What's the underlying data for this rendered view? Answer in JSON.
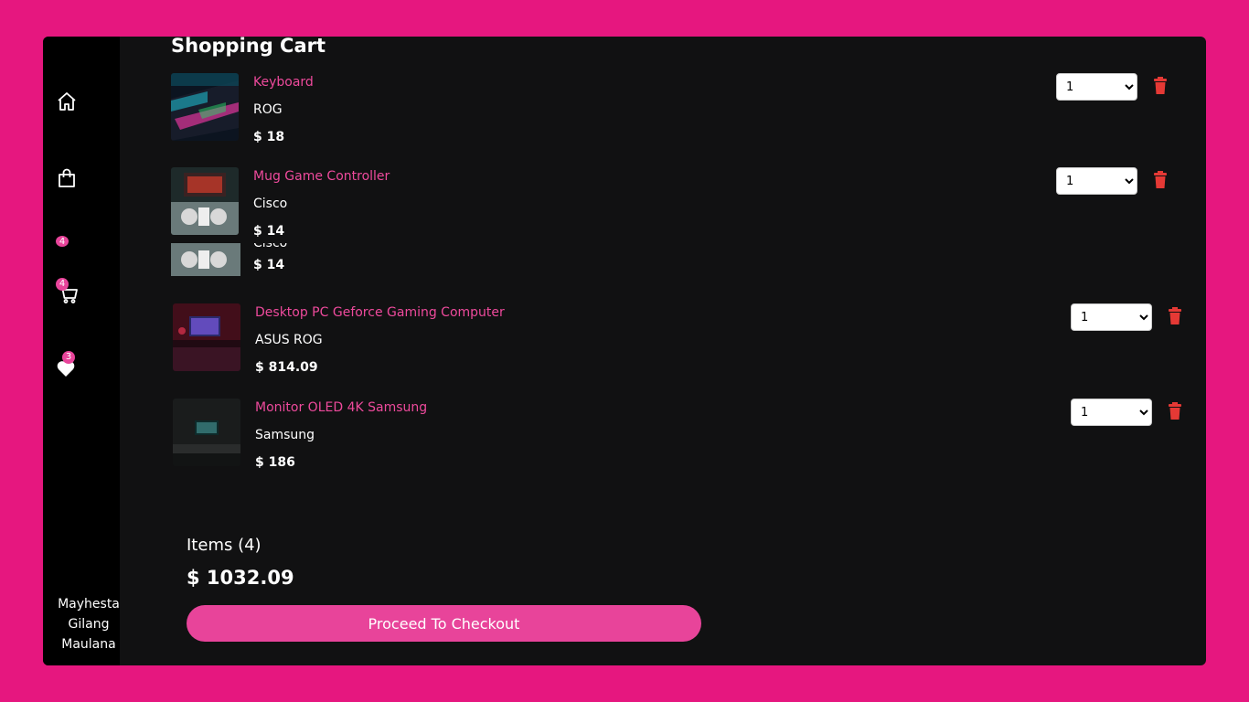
{
  "sidebar": {
    "icons": [
      "home-icon",
      "shopping-bag-icon",
      "cart-icon",
      "heart-icon"
    ],
    "cart_badge": "4",
    "ghost_badge": "4",
    "wishlist_badge": "3",
    "user_name": "Mayhesta Gilang Maulana"
  },
  "cart": {
    "title": "Shopping Cart",
    "items": [
      {
        "name": "Keyboard",
        "brand": "ROG",
        "price": "$ 18",
        "qty": "1"
      },
      {
        "name": "Mug Game Controller",
        "brand": "Cisco",
        "price": "$ 14",
        "qty": "1"
      },
      {
        "name": "Desktop PC Geforce Gaming Computer",
        "brand": "ASUS ROG",
        "price": "$ 814.09",
        "qty": "1"
      },
      {
        "name": "Monitor OLED 4K Samsung",
        "brand": "Samsung",
        "price": "$ 186",
        "qty": "1"
      }
    ],
    "ghost": {
      "brand": "Cisco",
      "price": "$ 14"
    }
  },
  "summary": {
    "items_label": "Items (4)",
    "total": "$ 1032.09",
    "checkout_label": "Proceed To Checkout"
  },
  "colors": {
    "page_bg": "#e6177f",
    "panel_bg": "#111112",
    "sidebar_bg": "#000000",
    "accent": "#e8449a",
    "delete": "#e53935"
  }
}
